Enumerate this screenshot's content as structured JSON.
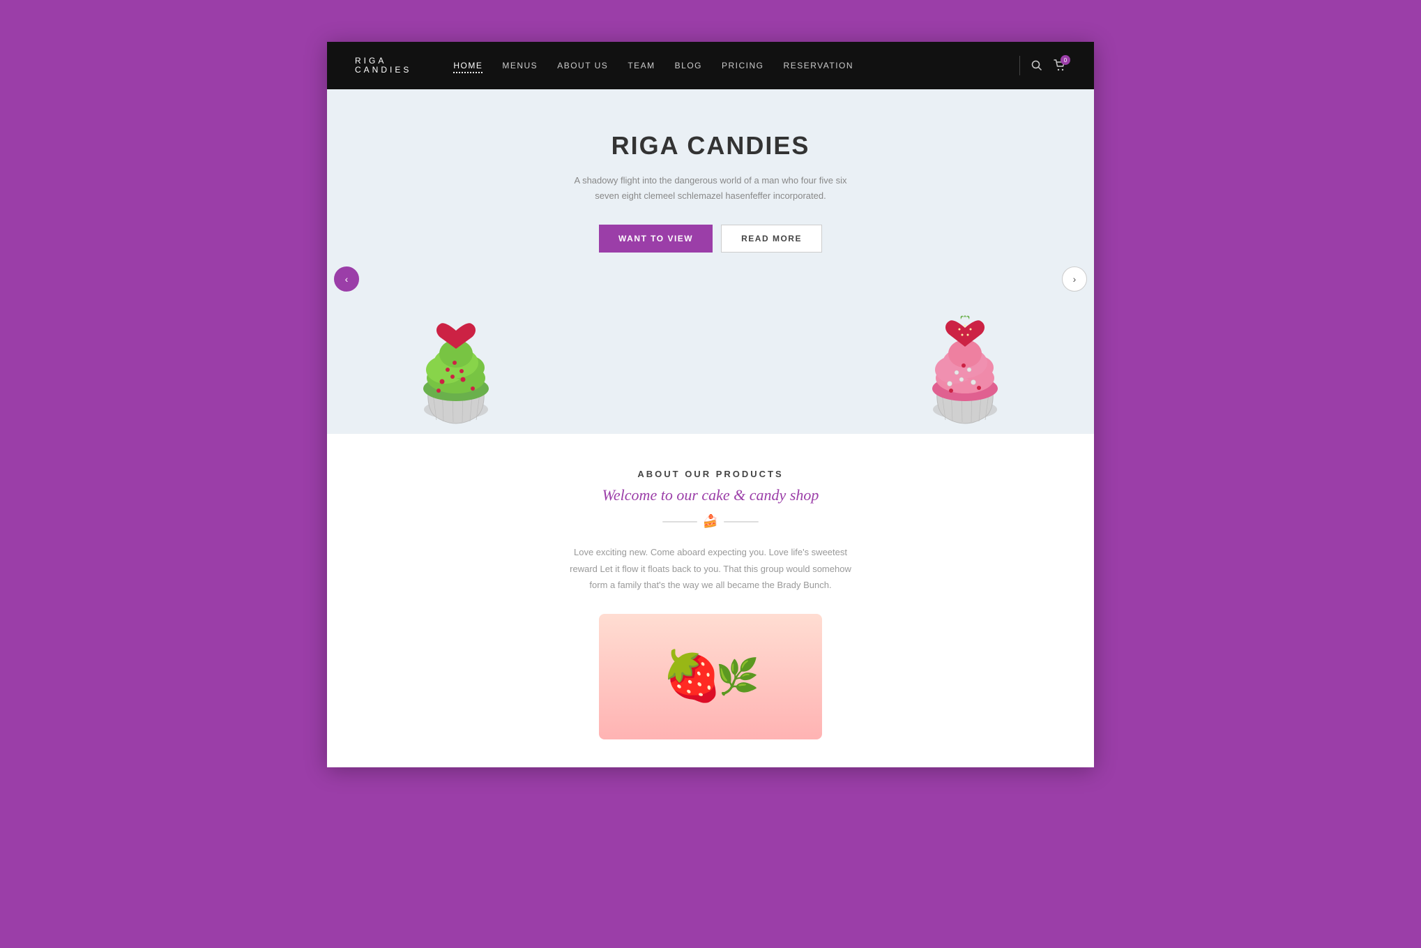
{
  "brand": {
    "name_line1": "RIGA",
    "name_line2": "CANDIES"
  },
  "nav": {
    "links": [
      {
        "label": "HOME",
        "active": true
      },
      {
        "label": "MENUS",
        "active": false
      },
      {
        "label": "ABOUT US",
        "active": false
      },
      {
        "label": "TEAM",
        "active": false
      },
      {
        "label": "BLOG",
        "active": false
      },
      {
        "label": "PRICING",
        "active": false
      },
      {
        "label": "RESERVATION",
        "active": false
      }
    ],
    "cart_count": "0"
  },
  "hero": {
    "title": "RIGA CANDIES",
    "subtitle": "A shadowy flight into the dangerous world of a man who  four five six seven eight clemeel schlemazel hasenfeffer incorporated.",
    "btn_primary": "WANT TO VIEW",
    "btn_secondary": "READ MORE"
  },
  "products": {
    "label": "ABOUT OUR PRODUCTS",
    "cursive": "Welcome to our cake & candy shop",
    "description": "Love exciting new. Come aboard  expecting you. Love life's sweetest reward Let it flow it floats back to you. That this group would somehow form a family that's the way we all became the Brady Bunch."
  }
}
